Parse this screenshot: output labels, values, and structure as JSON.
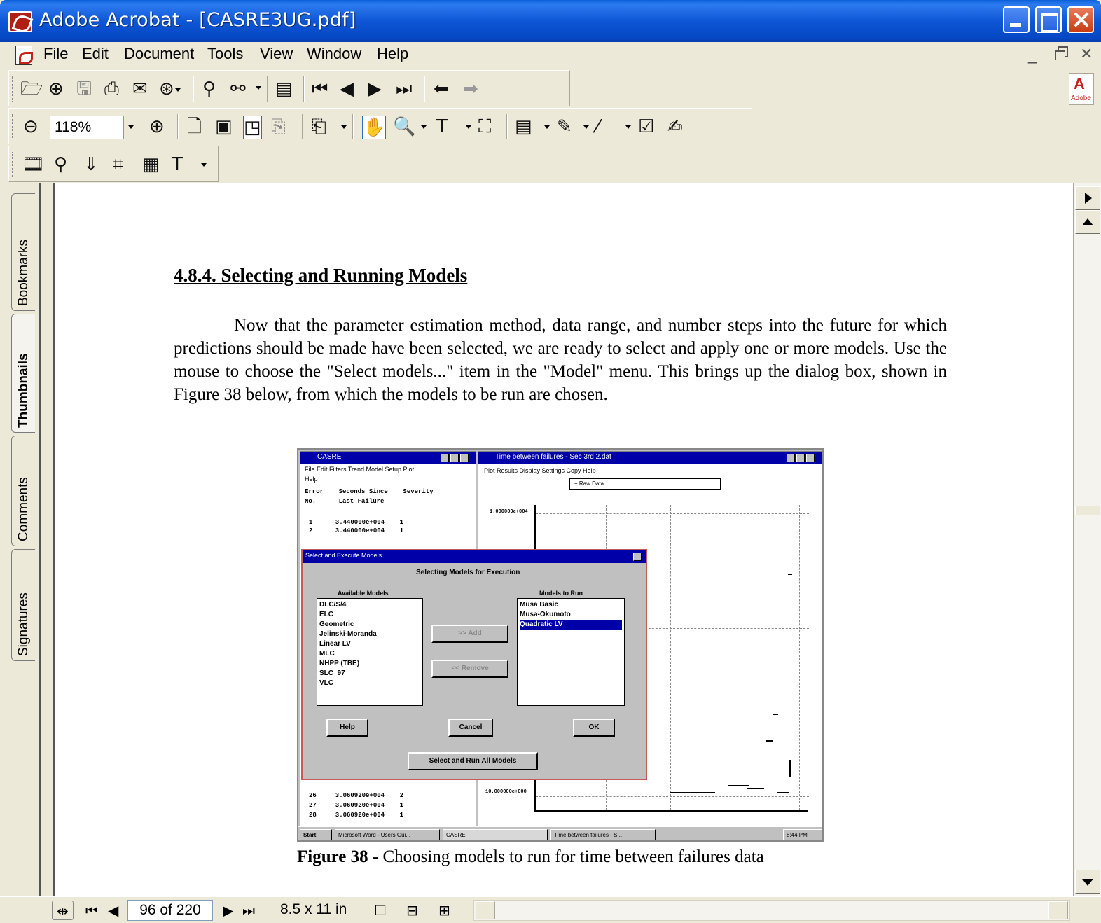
{
  "window": {
    "title": "Adobe Acrobat - [CASRE3UG.pdf]",
    "icon": "acrobat-icon"
  },
  "menu": {
    "items": [
      "File",
      "Edit",
      "Document",
      "Tools",
      "View",
      "Window",
      "Help"
    ]
  },
  "toolbar": {
    "zoom_value": "118%",
    "adobe_logo_text": "Adobe"
  },
  "nav_tabs": [
    "Bookmarks",
    "Thumbnails",
    "Comments",
    "Signatures"
  ],
  "document": {
    "heading": "4.8.4.   Selecting and Running Models",
    "paragraph": "Now that the parameter estimation method, data range, and number steps into the future for which predictions should be made have been selected, we are ready to select and apply one or more models.  Use the mouse to choose the \"Select models...\" item in the \"Model\" menu.  This brings up the dialog box, shown in Figure 38 below, from which the models to be run are chosen.",
    "caption_label": "Figure 38",
    "caption_text": " - Choosing models to run for time between failures data"
  },
  "figure": {
    "casre_title": "CASRE",
    "casre_menu": "File  Edit  Filters  Trend  Model  Setup  Plot",
    "casre_menu2": "Help",
    "col_headers": "Error    Seconds Since    Severity",
    "col_headers2": "No.      Last Failure",
    "rows_top": [
      "1      3.440000e+004    1",
      "2      3.440000e+004    1"
    ],
    "rows_bottom": [
      "26     3.060920e+004    2",
      "27     3.060920e+004    1",
      "28     3.060920e+004    1"
    ],
    "plot_title": "Time between failures - Sec 3rd 2.dat",
    "plot_menu": "Plot  Results  Display  Settings  Copy  Help",
    "plot_legend": "+ Raw Data",
    "y_tick_top": "1.000000e+004",
    "y_tick_bottom": "10.000000e+000",
    "dialog_title": "Select and Execute Models",
    "dialog_heading": "Selecting Models for Execution",
    "available_label": "Available Models",
    "run_label": "Models to Run",
    "available_models": [
      "DLC/S/4",
      "ELC",
      "Geometric",
      "Jelinski-Moranda",
      "Linear LV",
      "MLC",
      "NHPP (TBE)",
      "SLC_97",
      "VLC"
    ],
    "run_models": [
      "Musa Basic",
      "Musa-Okumoto",
      "Quadratic LV"
    ],
    "add_btn": ">> Add",
    "remove_btn": "<< Remove",
    "help_btn": "Help",
    "cancel_btn": "Cancel",
    "ok_btn": "OK",
    "run_all_btn": "Select and Run All Models",
    "taskbar": [
      "Start",
      "Microsoft Word - Users Gui...",
      "CASRE",
      "Time between failures - S...",
      "8:44 PM"
    ]
  },
  "statusbar": {
    "page_value": "96 of 220",
    "page_size": "8.5 x 11 in"
  }
}
